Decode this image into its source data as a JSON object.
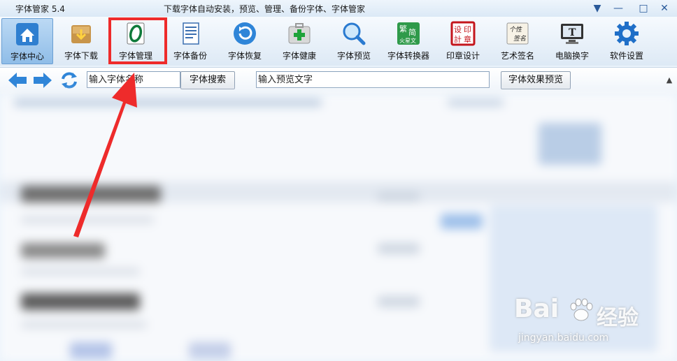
{
  "window": {
    "app_title": "字体管家 5.4",
    "tagline": "下载字体自动安装，预览、管理、备份字体、字体管家"
  },
  "toolbar": {
    "items": [
      {
        "label": "字体中心",
        "icon": "home-icon"
      },
      {
        "label": "字体下载",
        "icon": "download-box-icon"
      },
      {
        "label": "字体管理",
        "icon": "font-manage-icon"
      },
      {
        "label": "字体备份",
        "icon": "document-icon"
      },
      {
        "label": "字体恢复",
        "icon": "restore-icon"
      },
      {
        "label": "字体健康",
        "icon": "medkit-icon"
      },
      {
        "label": "字体预览",
        "icon": "magnifier-icon"
      },
      {
        "label": "字体转换器",
        "icon": "converter-icon",
        "glyphs": [
          "繁",
          "简",
          "火星文"
        ]
      },
      {
        "label": "印章设计",
        "icon": "seal-icon",
        "glyphs": [
          "设",
          "印",
          "計",
          "章"
        ]
      },
      {
        "label": "艺术签名",
        "icon": "signature-icon",
        "glyphs": [
          "个性",
          "签名"
        ]
      },
      {
        "label": "电脑换字",
        "icon": "monitor-icon",
        "glyphs": [
          "T"
        ]
      },
      {
        "label": "软件设置",
        "icon": "gear-icon"
      }
    ]
  },
  "search": {
    "font_name_placeholder": "输入字体名称",
    "search_button": "字体搜索",
    "preview_text_placeholder": "输入预览文字",
    "preview_button": "字体效果预览"
  },
  "watermark": {
    "brand": "Bai",
    "brand_cn": "经验",
    "url": "jingyan.baidu.com"
  },
  "colors": {
    "highlight": "#ee2b2b",
    "arrow": "#ee2b2b",
    "accent": "#2f7fd0"
  }
}
